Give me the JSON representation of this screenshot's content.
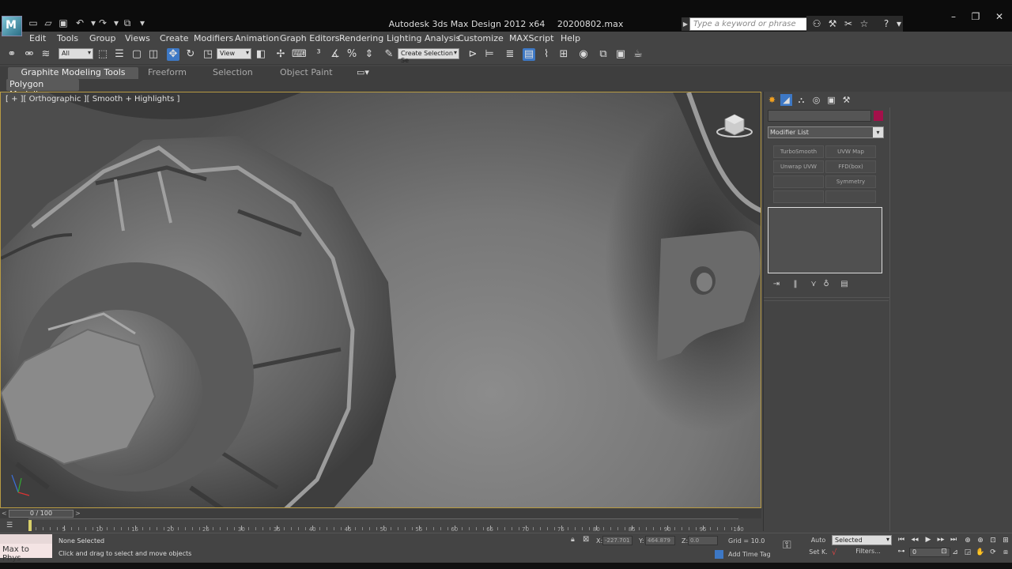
{
  "window": {
    "app_title": "Autodesk 3ds Max Design 2012 x64",
    "file_name": "20200802.max",
    "search_placeholder": "Type a keyword or phrase",
    "app_icon_text": "M"
  },
  "menu": [
    "Edit",
    "Tools",
    "Group",
    "Views",
    "Create",
    "Modifiers",
    "Animation",
    "Graph Editors",
    "Rendering",
    "Lighting Analysis",
    "Customize",
    "MAXScript",
    "Help"
  ],
  "toolbar": {
    "selection_filter": "All",
    "reference_coord": "View",
    "named_selection_placeholder": "Create Selection Se"
  },
  "ribbon": {
    "tabs": [
      "Graphite Modeling Tools",
      "Freeform",
      "Selection",
      "Object Paint"
    ],
    "panel": "Polygon Modeling"
  },
  "viewport": {
    "label": "[ + ][ Orthographic ][ Smooth + Highlights ]"
  },
  "command_panel": {
    "modifier_list": "Modifier List",
    "modifier_buttons": [
      "TurboSmooth",
      "UVW Map",
      "Unwrap UVW",
      "FFD(box)",
      "",
      "Symmetry",
      "",
      ""
    ],
    "object_color": "#a3104a"
  },
  "timeline": {
    "frame_display": "0 / 100",
    "ticks": [
      "0",
      "5",
      "10",
      "15",
      "20",
      "25",
      "30",
      "35",
      "40",
      "45",
      "50",
      "55",
      "60",
      "65",
      "70",
      "75",
      "80",
      "85",
      "90",
      "95",
      "100"
    ]
  },
  "status": {
    "maxscript": "Max to Phys",
    "selection": "None Selected",
    "prompt": "Click and drag to select and move objects",
    "x_label": "X:",
    "x_value": "-227.701",
    "y_label": "Y:",
    "y_value": "464.879",
    "z_label": "Z:",
    "z_value": "0.0",
    "grid": "Grid = 10.0",
    "add_time_tag": "Add Time Tag",
    "auto_key": "Auto",
    "set_key": "Set K.",
    "key_filter": "Selected",
    "filters": "Filters...",
    "current_frame": "0"
  }
}
